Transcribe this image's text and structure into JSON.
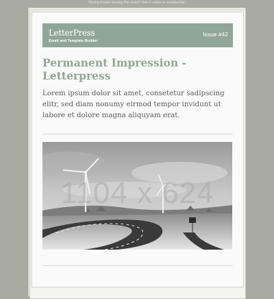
{
  "preheader": "Having trouble viewing this email? View it online or unsubscribe.",
  "header": {
    "brand": "LetterPress",
    "tagline": "Email and Template Builder",
    "issue": "Issue #42",
    "banner_color": "#91a698"
  },
  "article": {
    "headline": "Permanent Impression - Letterpress",
    "body": "Lorem ipsum dolor sit amet, consetetur sadipscing elitr, sed diam nonumy eirmod tempor invidunt ut labore et dolore magna aliquyam erat.",
    "image_placeholder": "1104 x 624",
    "image_subject": "wind turbines above a curving road"
  },
  "colors": {
    "background": "#a9aaa1",
    "accent": "#91a698",
    "body_text": "#5a5a5a"
  }
}
